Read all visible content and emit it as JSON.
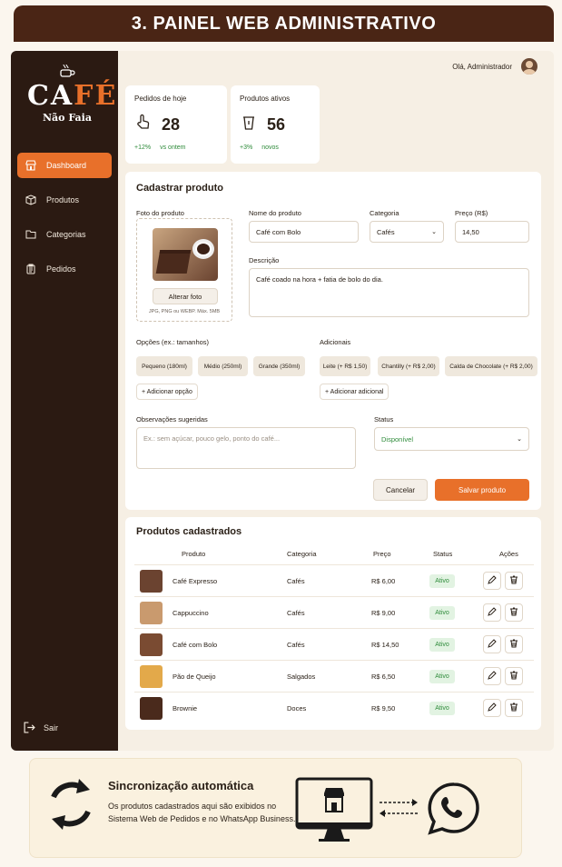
{
  "banner": {
    "title": "3. PAINEL WEB ADMINISTRATIVO"
  },
  "logo": {
    "word_a": "CA",
    "word_b": "FÉ",
    "tagline": "Não Faia"
  },
  "sidebar": {
    "items": [
      {
        "label": "Dashboard",
        "icon": "store-icon",
        "active": true
      },
      {
        "label": "Produtos",
        "icon": "box-icon"
      },
      {
        "label": "Categorias",
        "icon": "folder-icon"
      },
      {
        "label": "Pedidos",
        "icon": "clipboard-icon"
      }
    ],
    "logout": "Sair"
  },
  "header": {
    "greeting": "Olá, Administrador"
  },
  "stats": [
    {
      "label": "Pedidos de hoje",
      "value": "28",
      "delta": "+12%",
      "delta_note": "vs ontem"
    },
    {
      "label": "Produtos ativos",
      "value": "56",
      "delta": "+3%",
      "delta_note": "novos"
    }
  ],
  "form": {
    "title": "Cadastrar produto",
    "photo_label": "Foto do produto",
    "change_photo": "Alterar foto",
    "photo_hint": "JPG, PNG ou WEBP. Máx. 5MB",
    "name_label": "Nome do produto",
    "name_value": "Café com Bolo",
    "category_label": "Categoria",
    "category_value": "Cafés",
    "price_label": "Preço (R$)",
    "price_value": "14,50",
    "desc_label": "Descrição",
    "desc_value": "Café coado na hora + fatia de bolo do dia.",
    "options_label": "Opções (ex.: tamanhos)",
    "options": [
      "Pequeno (180ml)",
      "Médio (250ml)",
      "Grande (350ml)"
    ],
    "add_option": "+ Adicionar opção",
    "extras_label": "Adicionais",
    "extras": [
      "Leite (+ R$ 1,50)",
      "Chantilly (+ R$ 2,00)",
      "Calda de Chocolate (+ R$ 2,00)"
    ],
    "add_extra": "+ Adicionar adicional",
    "notes_label": "Observações sugeridas",
    "notes_placeholder": "Ex.: sem açúcar, pouco gelo, ponto do café...",
    "status_label": "Status",
    "status_value": "Disponível",
    "cancel": "Cancelar",
    "save": "Salvar produto"
  },
  "products": {
    "title": "Produtos cadastrados",
    "columns": [
      "Produto",
      "Categoria",
      "Preço",
      "Status",
      "Ações"
    ],
    "rows": [
      {
        "name": "Café Expresso",
        "category": "Cafés",
        "price": "R$ 6,00",
        "status": "Ativo",
        "thumb": "#6b4330"
      },
      {
        "name": "Cappuccino",
        "category": "Cafés",
        "price": "R$ 9,00",
        "status": "Ativo",
        "thumb": "#c99a6e"
      },
      {
        "name": "Café com Bolo",
        "category": "Cafés",
        "price": "R$ 14,50",
        "status": "Ativo",
        "thumb": "#7a4b32"
      },
      {
        "name": "Pão de Queijo",
        "category": "Salgados",
        "price": "R$ 6,50",
        "status": "Ativo",
        "thumb": "#e3a94a"
      },
      {
        "name": "Brownie",
        "category": "Doces",
        "price": "R$ 9,50",
        "status": "Ativo",
        "thumb": "#4a2a1c"
      }
    ]
  },
  "sync": {
    "title": "Sincronização automática",
    "text": "Os produtos cadastrados aqui são exibidos no Sistema Web de Pedidos e no WhatsApp Business."
  },
  "colors": {
    "accent": "#e8702a",
    "sidebar": "#2b1a12",
    "banner": "#4a2515",
    "success": "#2e8b3a"
  }
}
